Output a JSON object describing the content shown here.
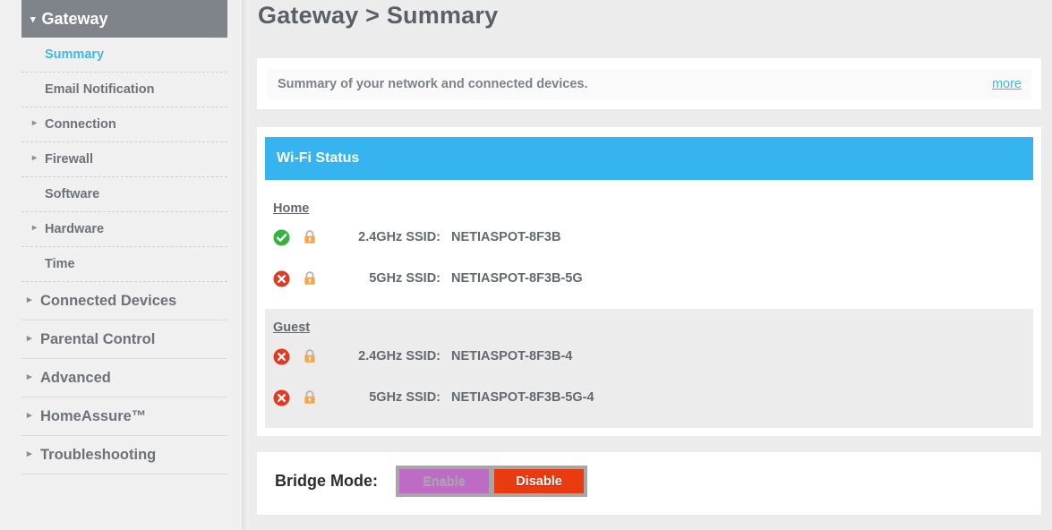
{
  "sidebar": {
    "header": {
      "label": "Gateway",
      "caret": "▾"
    },
    "items": [
      {
        "label": "Summary",
        "level": "sub",
        "caret": "",
        "active": true
      },
      {
        "label": "Email Notification",
        "level": "sub",
        "caret": "",
        "active": false
      },
      {
        "label": "Connection",
        "level": "sub",
        "caret": "▸",
        "active": false
      },
      {
        "label": "Firewall",
        "level": "sub",
        "caret": "▸",
        "active": false
      },
      {
        "label": "Software",
        "level": "sub",
        "caret": "",
        "active": false
      },
      {
        "label": "Hardware",
        "level": "sub",
        "caret": "▸",
        "active": false
      },
      {
        "label": "Time",
        "level": "sub",
        "caret": "",
        "active": false
      },
      {
        "label": "Connected Devices",
        "level": "top",
        "caret": "▸",
        "active": false
      },
      {
        "label": "Parental Control",
        "level": "top",
        "caret": "▸",
        "active": false
      },
      {
        "label": "Advanced",
        "level": "top",
        "caret": "▸",
        "active": false
      },
      {
        "label": "HomeAssure™",
        "level": "top",
        "caret": "▸",
        "active": false
      },
      {
        "label": "Troubleshooting",
        "level": "top",
        "caret": "▸",
        "active": false
      }
    ]
  },
  "page": {
    "title": "Gateway > Summary"
  },
  "summary": {
    "text": "Summary of your network and connected devices.",
    "more_label": "more"
  },
  "wifi": {
    "header": "Wi-Fi Status",
    "groups": [
      {
        "name": "Home",
        "rows": [
          {
            "status": "enabled",
            "status_icon": "check-circle-icon",
            "lock_icon": "lock-icon",
            "label": "2.4GHz SSID:",
            "value": "NETIASPOT-8F3B"
          },
          {
            "status": "disabled",
            "status_icon": "x-circle-icon",
            "lock_icon": "lock-icon",
            "label": "5GHz SSID:",
            "value": "NETIASPOT-8F3B-5G"
          }
        ]
      },
      {
        "name": "Guest",
        "rows": [
          {
            "status": "disabled",
            "status_icon": "x-circle-icon",
            "lock_icon": "lock-icon",
            "label": "2.4GHz SSID:",
            "value": "NETIASPOT-8F3B-4"
          },
          {
            "status": "disabled",
            "status_icon": "x-circle-icon",
            "lock_icon": "lock-icon",
            "label": "5GHz SSID:",
            "value": "NETIASPOT-8F3B-5G-4"
          }
        ]
      }
    ]
  },
  "bridge": {
    "label": "Bridge Mode:",
    "enable_label": "Enable",
    "disable_label": "Disable",
    "selected": "Disable"
  },
  "colors": {
    "accent_blue": "#36b4ef",
    "link_blue": "#3fb8ee",
    "nav_header_gray": "#7e848a",
    "status_ok_green": "#33b441",
    "status_off_red": "#e03a23",
    "lock_orange": "#f7a54a",
    "disable_red": "#ea3a10",
    "enable_purple": "#bd6bc4",
    "page_bg": "#ececec"
  }
}
